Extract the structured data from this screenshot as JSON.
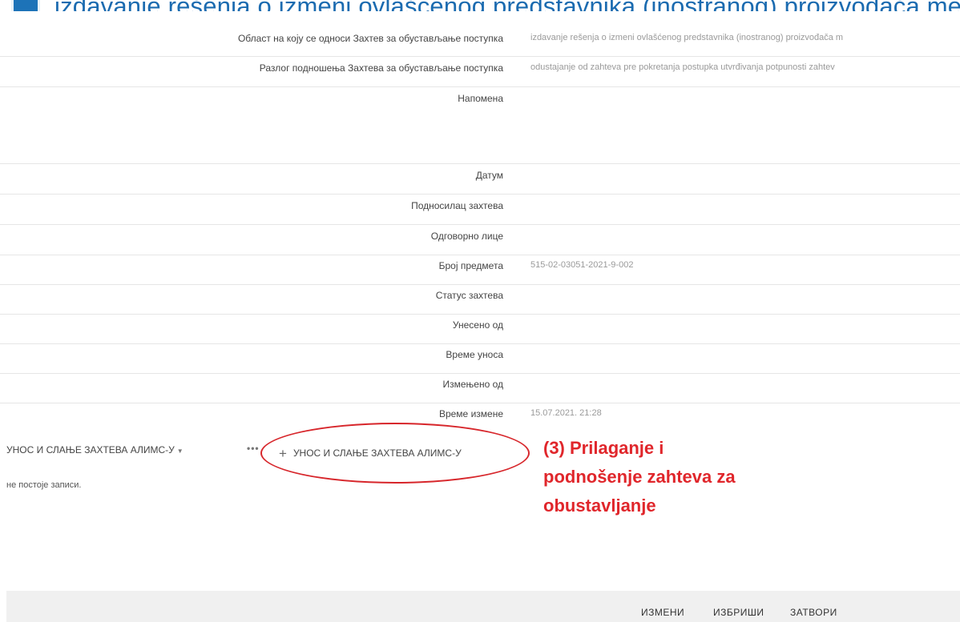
{
  "header": {
    "title": "izdavanje rešenja o izmeni ovlašćenog predstavnika (inostranog) proizvođača medi"
  },
  "fields": [
    {
      "label": "Област на коју се односи Захтев за обустављање поступка",
      "value": "izdavanje rešenja o izmeni ovlašćenog predstavnika (inostranog) proizvođača m"
    },
    {
      "label": "Разлог подношења Захтева за обустављање поступка",
      "value": "odustajanje od zahteva pre pokretanja postupka utvrđivanja potpunosti zahtev"
    },
    {
      "label": "Напомена",
      "value": ""
    },
    {
      "label": "Датум",
      "value": ""
    },
    {
      "label": "Подносилац захтева",
      "value": ""
    },
    {
      "label": "Одговорно лице",
      "value": ""
    },
    {
      "label": "Број предмета",
      "value": "515-02-03051-2021-9-002"
    },
    {
      "label": "Статус захтева",
      "value": ""
    },
    {
      "label": "Унесено од",
      "value": ""
    },
    {
      "label": "Време уноса",
      "value": ""
    },
    {
      "label": "Измењено од",
      "value": ""
    },
    {
      "label": "Време измене",
      "value": "15.07.2021. 21:28"
    }
  ],
  "subgrid": {
    "title": "УНОС И СЛАЊЕ ЗАХТЕВА АЛИМС-У",
    "ellipsis": "•••",
    "add_label": "УНОС И СЛАЊЕ ЗАХТЕВА АЛИМС-У",
    "empty_text": "не постоје записи."
  },
  "annotation": {
    "line1": "(3) Prilaganje i",
    "line2": "podnošenje zahteva za",
    "line3": "obustavljanje"
  },
  "footer": {
    "edit": "ИЗМЕНИ",
    "delete": "ИЗБРИШИ",
    "close": "ЗАТВОРИ"
  },
  "colors": {
    "accent": "#1b6bb0",
    "annotation": "#e0262b"
  }
}
